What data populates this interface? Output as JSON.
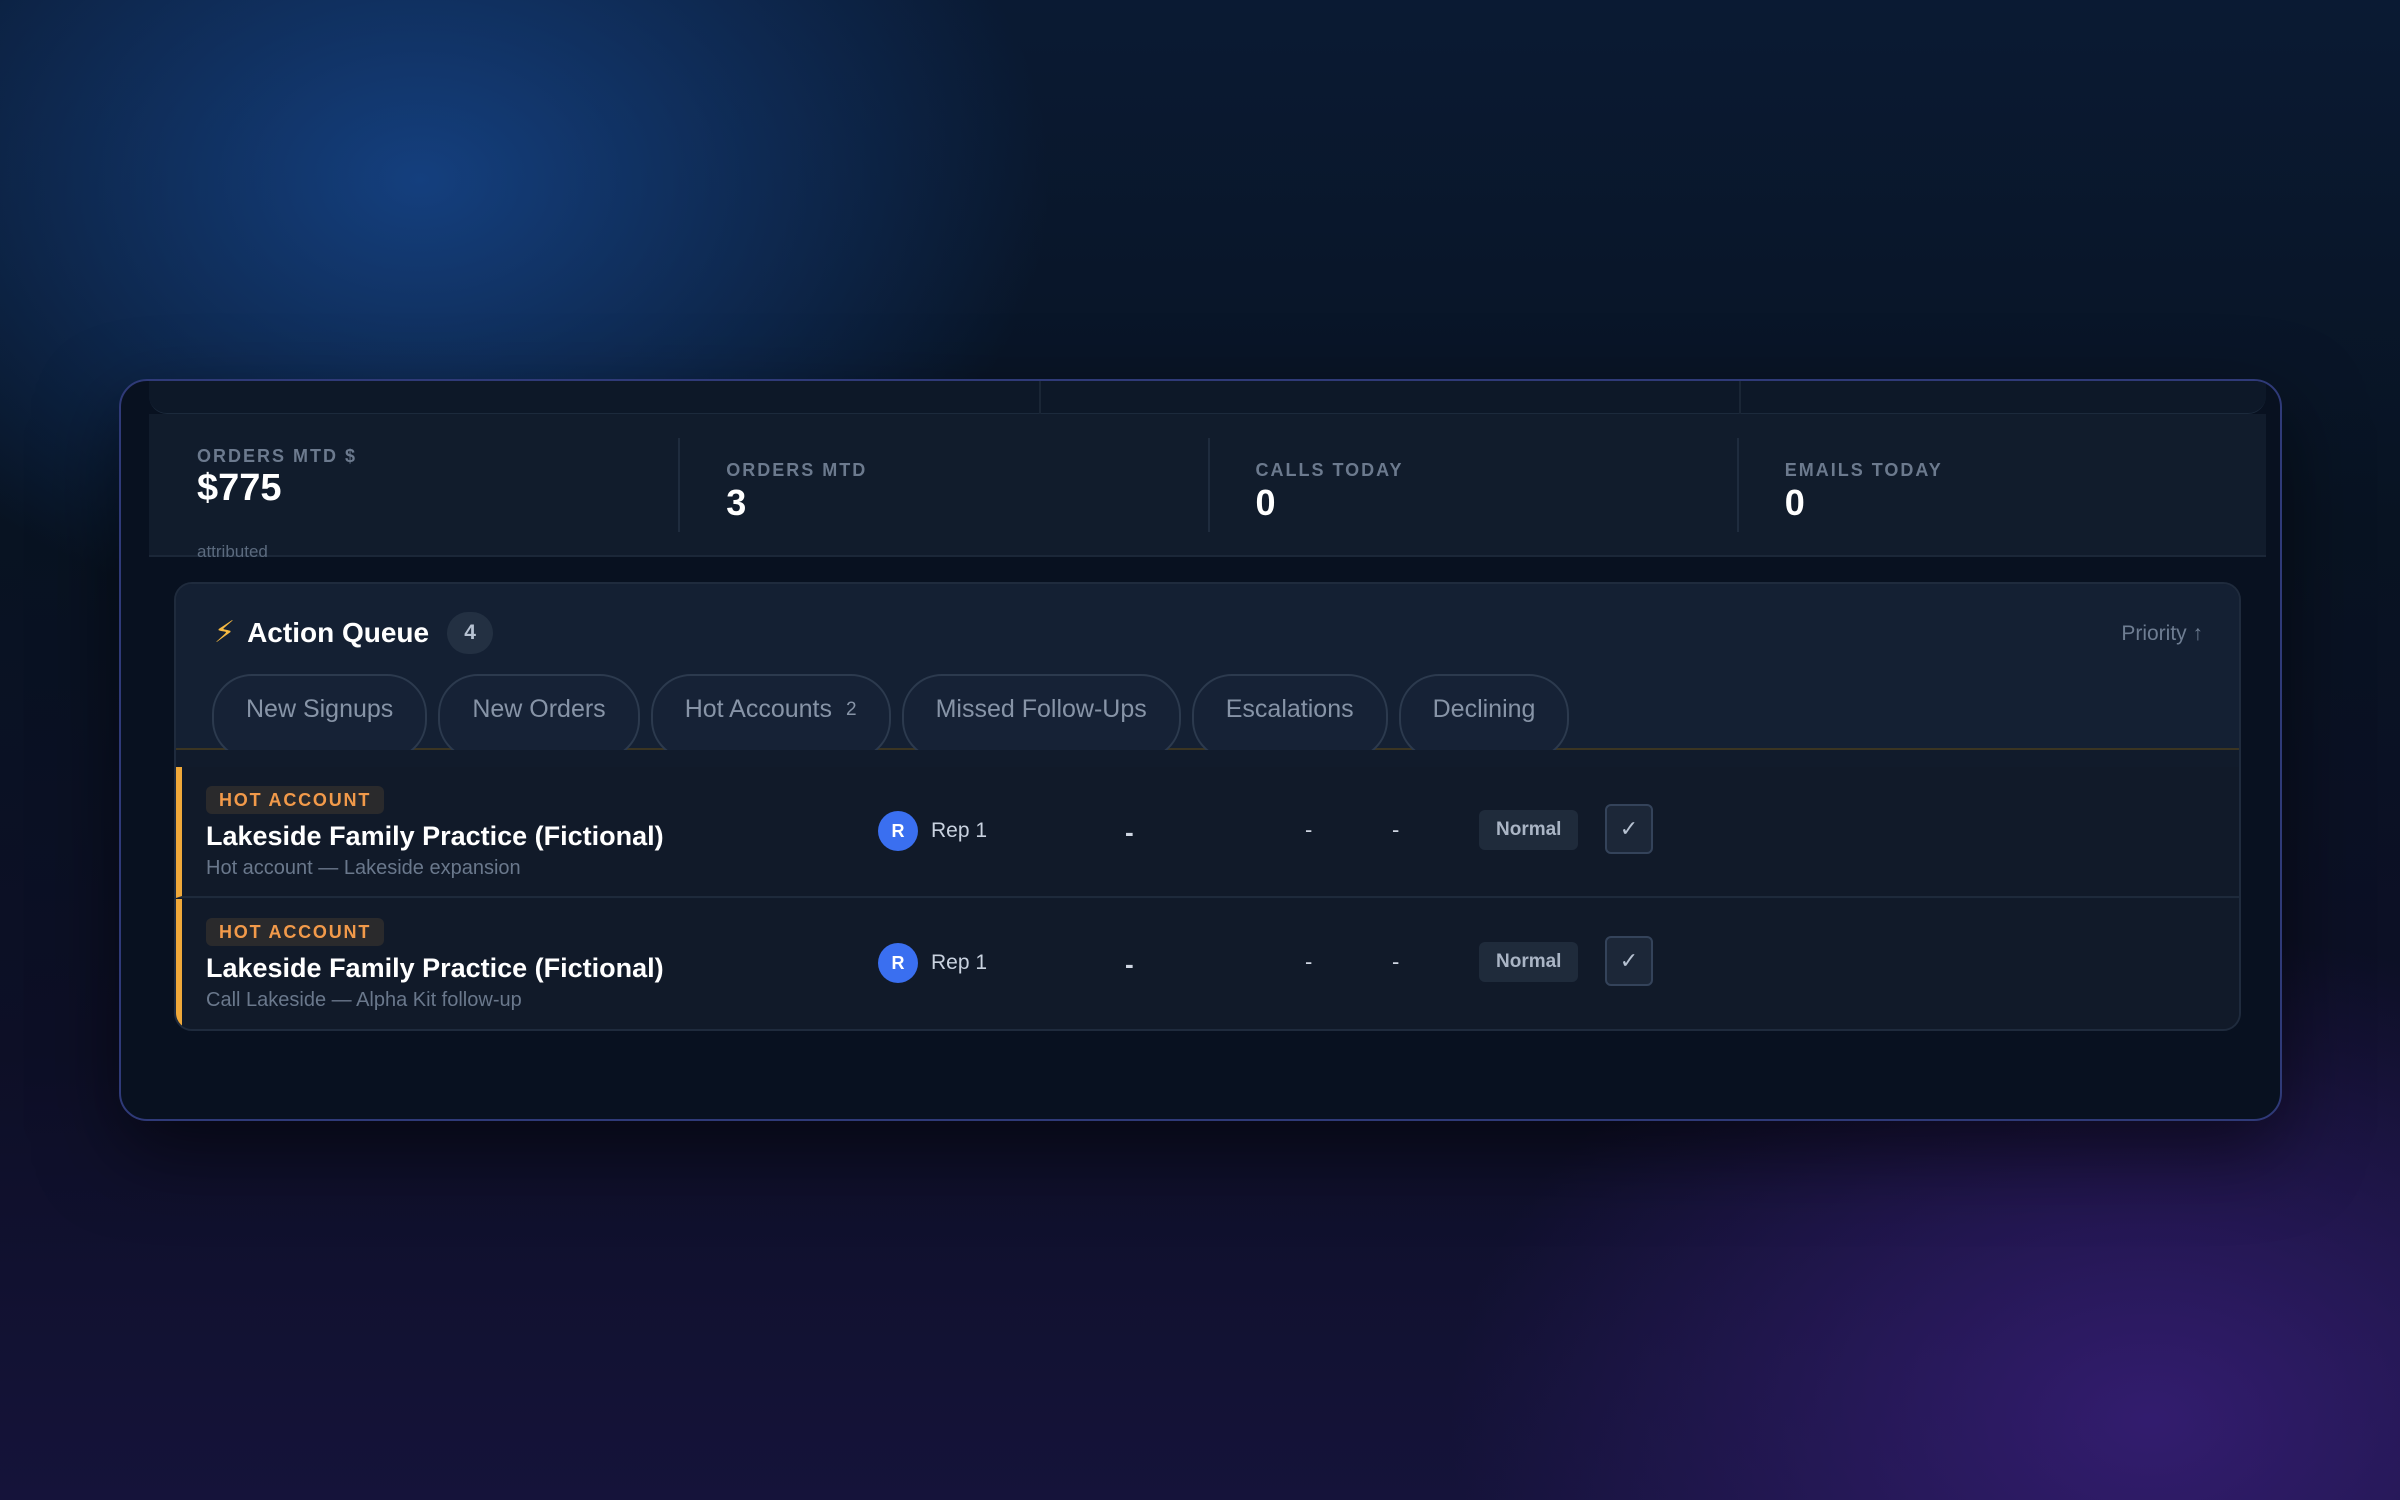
{
  "stats": [
    {
      "label": "ORDERS MTD $",
      "value": "$775",
      "sub": "attributed"
    },
    {
      "label": "ORDERS MTD",
      "value": "3"
    },
    {
      "label": "CALLS TODAY",
      "value": "0"
    },
    {
      "label": "EMAILS TODAY",
      "value": "0"
    }
  ],
  "queue": {
    "title": "Action Queue",
    "count": "4",
    "sort_label": "Priority ↑",
    "tabs": [
      {
        "label": "New Signups"
      },
      {
        "label": "New Orders"
      },
      {
        "label": "Hot Accounts",
        "badge": "2"
      },
      {
        "label": "Missed Follow-Ups"
      },
      {
        "label": "Escalations"
      },
      {
        "label": "Declining"
      }
    ],
    "rows": [
      {
        "tag": "HOT ACCOUNT",
        "account": "Lakeside Family Practice (Fictional)",
        "note": "Hot account — Lakeside expansion",
        "rep_initial": "R",
        "rep_name": "Rep 1",
        "col1": "-",
        "col2": "-",
        "col3": "-",
        "priority": "Normal",
        "check": "✓"
      },
      {
        "tag": "HOT ACCOUNT",
        "account": "Lakeside Family Practice (Fictional)",
        "note": "Call Lakeside — Alpha Kit follow-up",
        "rep_initial": "R",
        "rep_name": "Rep 1",
        "col1": "-",
        "col2": "-",
        "col3": "-",
        "priority": "Normal",
        "check": "✓"
      }
    ]
  },
  "colors": {
    "accent_hot": "#f0a93a",
    "tag_text": "#f29a4a",
    "avatar": "#3a6ff0",
    "frame_border": "#2f3a78"
  },
  "icons": {
    "queue_icon": "lightning-bolt-icon",
    "complete_icon": "check-icon"
  }
}
